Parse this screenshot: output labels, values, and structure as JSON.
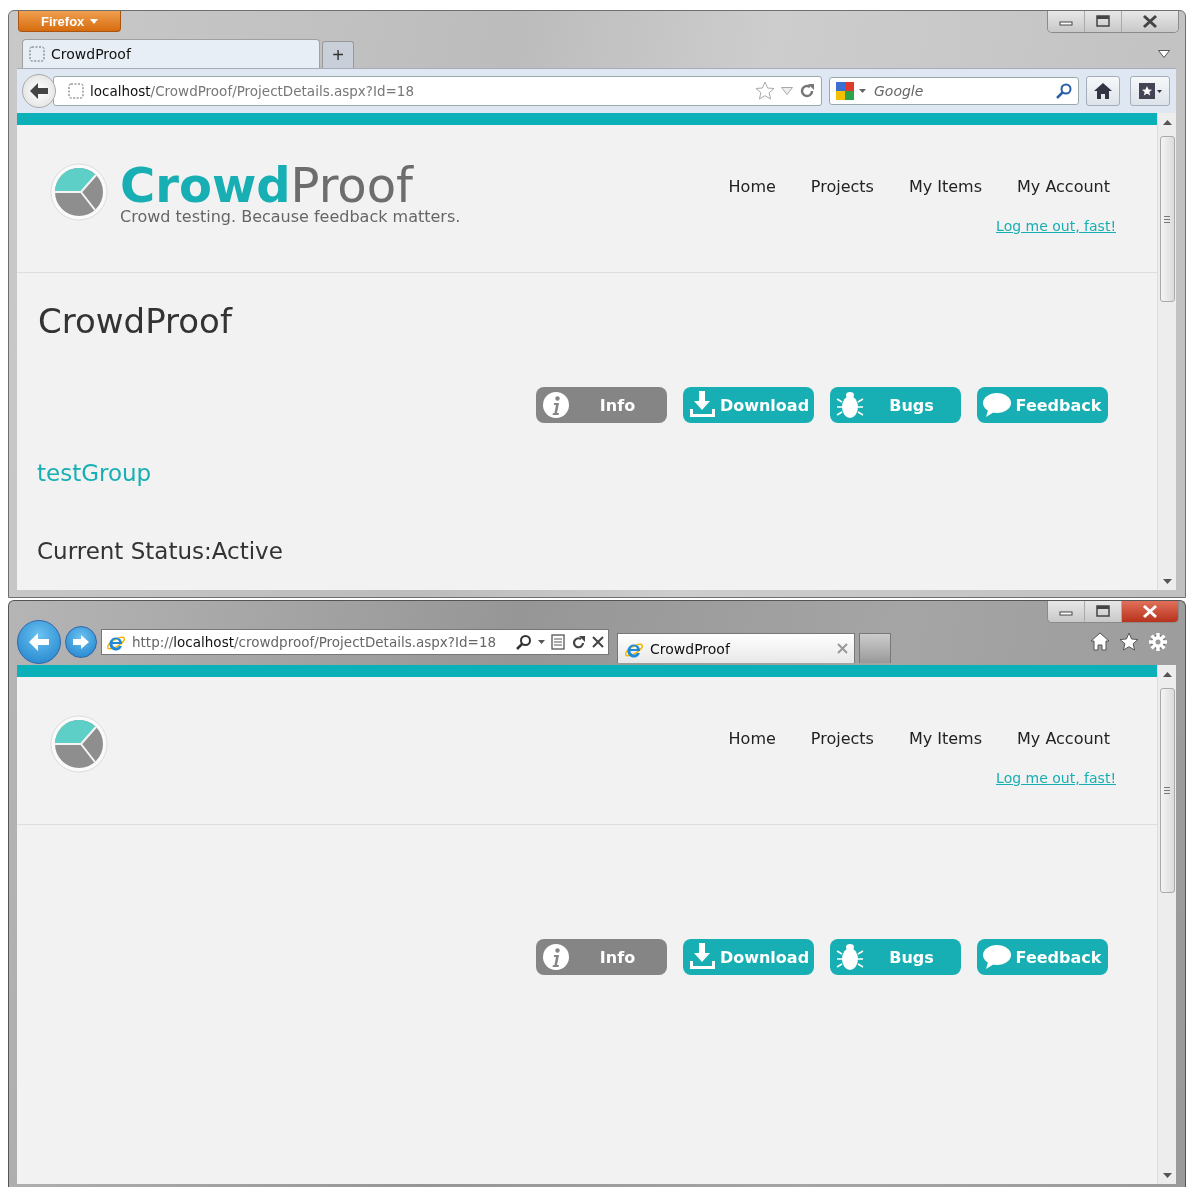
{
  "firefox": {
    "menu_button": "Firefox",
    "tabs": [
      {
        "label": "CrowdProof",
        "selected": true
      }
    ],
    "new_tab": "+",
    "url": {
      "host": "localhost",
      "path": "/CrowdProof/ProjectDetails.aspx?Id=18"
    },
    "search": {
      "placeholder": "Google"
    },
    "page": {
      "logo_text": [
        "Crowd",
        "Proof"
      ],
      "tagline": "Crowd testing. Because feedback matters.",
      "nav": [
        "Home",
        "Projects",
        "My Items",
        "My Account"
      ],
      "logout": "Log me out, fast!",
      "heading": "CrowdProof",
      "buttons": [
        {
          "kind": "info",
          "label": "Info"
        },
        {
          "kind": "download",
          "label": "Download"
        },
        {
          "kind": "bugs",
          "label": "Bugs"
        },
        {
          "kind": "feedback",
          "label": "Feedback"
        }
      ],
      "group_link": "testGroup",
      "status": "Current Status:Active"
    }
  },
  "ie": {
    "url": {
      "scheme": "http://",
      "host": "localhost",
      "path": "/crowdproof/ProjectDetails.aspx?Id=18"
    },
    "tabs": [
      {
        "label": "CrowdProof",
        "selected": true
      }
    ],
    "page": {
      "nav": [
        "Home",
        "Projects",
        "My Items",
        "My Account"
      ],
      "logout": "Log me out, fast!",
      "buttons": [
        {
          "kind": "info",
          "label": "Info"
        },
        {
          "kind": "download",
          "label": "Download"
        },
        {
          "kind": "bugs",
          "label": "Bugs"
        },
        {
          "kind": "feedback",
          "label": "Feedback"
        }
      ]
    }
  }
}
